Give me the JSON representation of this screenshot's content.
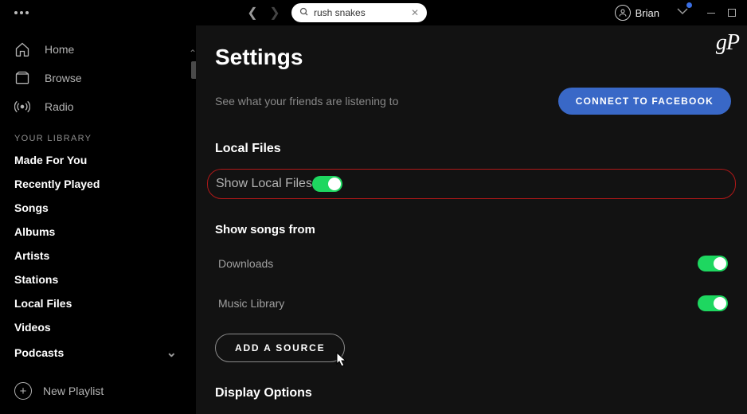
{
  "top": {
    "search_value": "rush snakes",
    "user_name": "Brian"
  },
  "watermark": "gP",
  "sidebar": {
    "primary": [
      {
        "label": "Home"
      },
      {
        "label": "Browse"
      },
      {
        "label": "Radio"
      }
    ],
    "library_header": "YOUR LIBRARY",
    "library": [
      {
        "label": "Made For You"
      },
      {
        "label": "Recently Played"
      },
      {
        "label": "Songs"
      },
      {
        "label": "Albums"
      },
      {
        "label": "Artists"
      },
      {
        "label": "Stations"
      },
      {
        "label": "Local Files"
      },
      {
        "label": "Videos"
      },
      {
        "label": "Podcasts"
      }
    ],
    "new_playlist": "New Playlist"
  },
  "settings": {
    "title": "Settings",
    "friends_text": "See what your friends are listening to",
    "fb_button": "CONNECT TO FACEBOOK",
    "local_files_header": "Local Files",
    "show_local_files_label": "Show Local Files",
    "show_songs_from": "Show songs from",
    "sources": [
      {
        "label": "Downloads"
      },
      {
        "label": "Music Library"
      }
    ],
    "add_source": "ADD A SOURCE",
    "display_options": "Display Options"
  }
}
